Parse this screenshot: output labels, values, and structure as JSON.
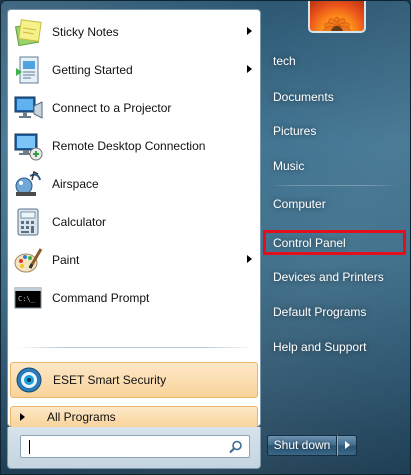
{
  "pinned_programs": [
    {
      "label": "Sticky Notes",
      "icon": "sticky-notes-icon",
      "has_submenu": true
    },
    {
      "label": "Getting Started",
      "icon": "getting-started-icon",
      "has_submenu": true
    },
    {
      "label": "Connect to a Projector",
      "icon": "projector-icon",
      "has_submenu": false
    },
    {
      "label": "Remote Desktop Connection",
      "icon": "remote-desktop-icon",
      "has_submenu": false
    },
    {
      "label": "Airspace",
      "icon": "airspace-icon",
      "has_submenu": false
    },
    {
      "label": "Calculator",
      "icon": "calculator-icon",
      "has_submenu": false
    },
    {
      "label": "Paint",
      "icon": "paint-icon",
      "has_submenu": true
    },
    {
      "label": "Command Prompt",
      "icon": "command-prompt-icon",
      "has_submenu": false
    }
  ],
  "highlighted_program": {
    "label": "ESET Smart Security",
    "icon": "eset-icon"
  },
  "all_programs": {
    "label": "All Programs"
  },
  "search": {
    "value": ""
  },
  "right_pane": {
    "groups": [
      [
        "tech",
        "Documents",
        "Pictures",
        "Music"
      ],
      [
        "Computer",
        "Control Panel",
        "Devices and Printers",
        "Default Programs",
        "Help and Support"
      ]
    ],
    "highlighted": "Control Panel",
    "items": {
      "tech": "tech",
      "documents": "Documents",
      "pictures": "Pictures",
      "music": "Music",
      "computer": "Computer",
      "control_panel": "Control Panel",
      "devices_printers": "Devices and Printers",
      "default_programs": "Default Programs",
      "help_support": "Help and Support"
    }
  },
  "shutdown": {
    "label": "Shut down"
  },
  "colors": {
    "highlight_box": "#e2101d",
    "hover_fill": "#f9d39a",
    "pane_background": "#3f7391"
  }
}
